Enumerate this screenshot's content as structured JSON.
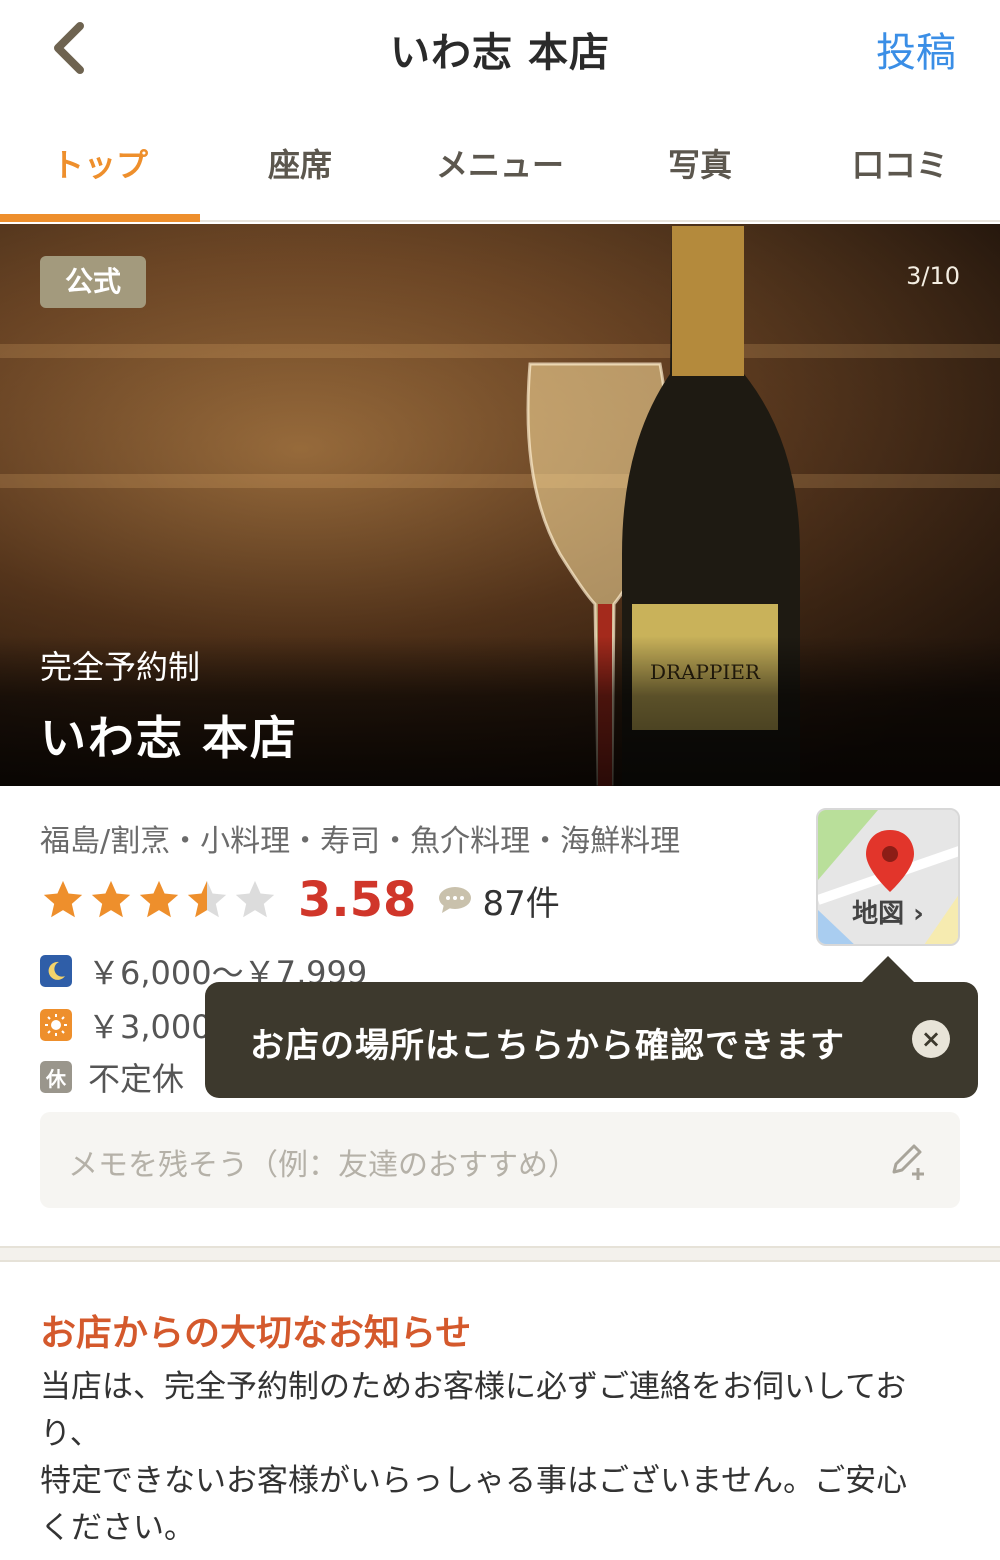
{
  "header": {
    "title": "いわ志 本店",
    "post_label": "投稿"
  },
  "tabs": [
    {
      "label": "トップ",
      "active": true
    },
    {
      "label": "座席"
    },
    {
      "label": "メニュー"
    },
    {
      "label": "写真"
    },
    {
      "label": "口コミ"
    }
  ],
  "hero": {
    "badge": "公式",
    "photo_counter": "3/10",
    "subtitle": "完全予約制",
    "title": "いわ志 本店"
  },
  "info": {
    "genre": "福島/割烹・小料理・寿司・魚介料理・海鮮料理",
    "rating": 3.58,
    "rating_text": "3.58",
    "review_count": "87件",
    "dinner_price": "￥6,000～￥7,999",
    "lunch_price": "￥3,000",
    "holiday_icon": "休",
    "holiday": "不定休",
    "map_label": "地図"
  },
  "tooltip": {
    "text": "お店の場所はこちらから確認できます",
    "close": "×"
  },
  "memo": {
    "placeholder": "メモを残そう（例：友達のおすすめ）"
  },
  "notice": {
    "title": "お店からの大切なお知らせ",
    "body": "当店は、完全予約制のためお客様に必ずご連絡をお伺いしてお\nり、\n特定できないお客様がいらっしゃる事はございません。ご安心\nください。"
  },
  "colors": {
    "accent": "#ee8f2c",
    "link": "#3a8ee6",
    "score": "#d0362a",
    "notice_title": "#d4592c",
    "tooltip_bg": "#3d392d",
    "badge_bg": "#a39a7d"
  }
}
